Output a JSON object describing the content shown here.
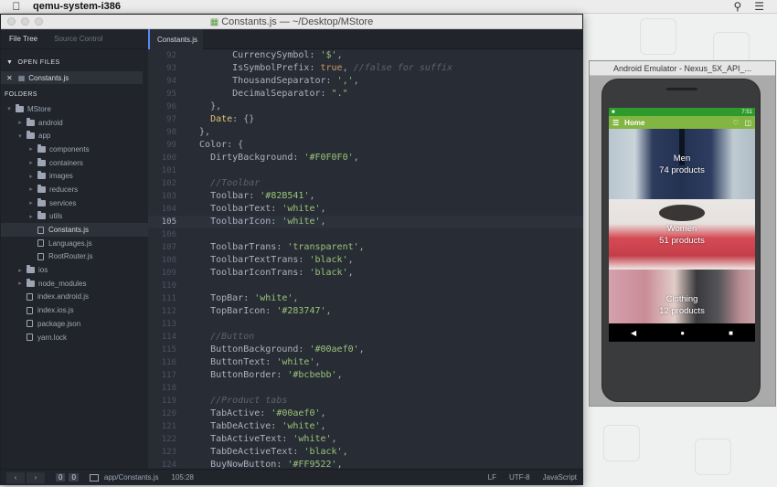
{
  "menubar": {
    "app": "qemu-system-i386"
  },
  "editor": {
    "title": "Constants.js — ~/Desktop/MStore",
    "panel_tabs": [
      "File Tree",
      "Source Control"
    ],
    "open_files_label": "OPEN FILES",
    "open_file": "Constants.js",
    "folders_label": "FOLDERS",
    "tree": [
      {
        "label": "MStore",
        "depth": 0,
        "type": "folder",
        "open": true
      },
      {
        "label": "android",
        "depth": 1,
        "type": "folder",
        "open": false
      },
      {
        "label": "app",
        "depth": 1,
        "type": "folder",
        "open": true
      },
      {
        "label": "components",
        "depth": 2,
        "type": "folder",
        "open": false
      },
      {
        "label": "containers",
        "depth": 2,
        "type": "folder",
        "open": false
      },
      {
        "label": "images",
        "depth": 2,
        "type": "folder",
        "open": false
      },
      {
        "label": "reducers",
        "depth": 2,
        "type": "folder",
        "open": false
      },
      {
        "label": "services",
        "depth": 2,
        "type": "folder",
        "open": false
      },
      {
        "label": "utils",
        "depth": 2,
        "type": "folder",
        "open": false
      },
      {
        "label": "Constants.js",
        "depth": 2,
        "type": "file",
        "selected": true
      },
      {
        "label": "Languages.js",
        "depth": 2,
        "type": "file"
      },
      {
        "label": "RootRouter.js",
        "depth": 2,
        "type": "file"
      },
      {
        "label": "ios",
        "depth": 1,
        "type": "folder",
        "open": false
      },
      {
        "label": "node_modules",
        "depth": 1,
        "type": "folder",
        "open": false
      },
      {
        "label": "index.android.js",
        "depth": 1,
        "type": "file"
      },
      {
        "label": "index.ios.js",
        "depth": 1,
        "type": "file"
      },
      {
        "label": "package.json",
        "depth": 1,
        "type": "file"
      },
      {
        "label": "yarn.lock",
        "depth": 1,
        "type": "file"
      }
    ],
    "active_tab": "Constants.js",
    "active_line": 105,
    "code": [
      {
        "n": 92,
        "t": [
          [
            "p",
            "        CurrencySymbol: "
          ],
          [
            "s",
            "'$'"
          ],
          [
            "p",
            ","
          ]
        ]
      },
      {
        "n": 93,
        "t": [
          [
            "p",
            "        IsSymbolPrefix: "
          ],
          [
            "b",
            "true"
          ],
          [
            "p",
            ", "
          ],
          [
            "c",
            "//false for suffix"
          ]
        ]
      },
      {
        "n": 94,
        "t": [
          [
            "p",
            "        ThousandSeparator: "
          ],
          [
            "s",
            "','"
          ],
          [
            "p",
            ","
          ]
        ]
      },
      {
        "n": 95,
        "t": [
          [
            "p",
            "        DecimalSeparator: "
          ],
          [
            "s",
            "\".\""
          ]
        ]
      },
      {
        "n": 96,
        "t": [
          [
            "p",
            "    },"
          ]
        ]
      },
      {
        "n": 97,
        "t": [
          [
            "y",
            "    Date"
          ],
          [
            "p",
            ": {}"
          ]
        ]
      },
      {
        "n": 98,
        "t": [
          [
            "p",
            "  },"
          ]
        ]
      },
      {
        "n": 99,
        "t": [
          [
            "p",
            "  Color: {"
          ]
        ]
      },
      {
        "n": 100,
        "t": [
          [
            "p",
            "    DirtyBackground: "
          ],
          [
            "s",
            "'#F0F0F0'"
          ],
          [
            "p",
            ","
          ]
        ]
      },
      {
        "n": 101,
        "t": []
      },
      {
        "n": 102,
        "t": [
          [
            "c",
            "    //Toolbar"
          ]
        ]
      },
      {
        "n": 103,
        "t": [
          [
            "p",
            "    Toolbar: "
          ],
          [
            "s",
            "'#82B541'"
          ],
          [
            "p",
            ","
          ]
        ]
      },
      {
        "n": 104,
        "t": [
          [
            "p",
            "    ToolbarText: "
          ],
          [
            "s",
            "'white'"
          ],
          [
            "p",
            ","
          ]
        ]
      },
      {
        "n": 105,
        "t": [
          [
            "p",
            "    ToolbarIcon: "
          ],
          [
            "s",
            "'white'"
          ],
          [
            "p",
            ","
          ]
        ]
      },
      {
        "n": 106,
        "t": []
      },
      {
        "n": 107,
        "t": [
          [
            "p",
            "    ToolbarTrans: "
          ],
          [
            "s",
            "'transparent'"
          ],
          [
            "p",
            ","
          ]
        ]
      },
      {
        "n": 108,
        "t": [
          [
            "p",
            "    ToolbarTextTrans: "
          ],
          [
            "s",
            "'black'"
          ],
          [
            "p",
            ","
          ]
        ]
      },
      {
        "n": 109,
        "t": [
          [
            "p",
            "    ToolbarIconTrans: "
          ],
          [
            "s",
            "'black'"
          ],
          [
            "p",
            ","
          ]
        ]
      },
      {
        "n": 110,
        "t": []
      },
      {
        "n": 111,
        "t": [
          [
            "p",
            "    TopBar: "
          ],
          [
            "s",
            "'white'"
          ],
          [
            "p",
            ","
          ]
        ]
      },
      {
        "n": 112,
        "t": [
          [
            "p",
            "    TopBarIcon: "
          ],
          [
            "s",
            "'#283747'"
          ],
          [
            "p",
            ","
          ]
        ]
      },
      {
        "n": 113,
        "t": []
      },
      {
        "n": 114,
        "t": [
          [
            "c",
            "    //Button"
          ]
        ]
      },
      {
        "n": 115,
        "t": [
          [
            "p",
            "    ButtonBackground: "
          ],
          [
            "s",
            "'#00aef0'"
          ],
          [
            "p",
            ","
          ]
        ]
      },
      {
        "n": 116,
        "t": [
          [
            "p",
            "    ButtonText: "
          ],
          [
            "s",
            "'white'"
          ],
          [
            "p",
            ","
          ]
        ]
      },
      {
        "n": 117,
        "t": [
          [
            "p",
            "    ButtonBorder: "
          ],
          [
            "s",
            "'#bcbebb'"
          ],
          [
            "p",
            ","
          ]
        ]
      },
      {
        "n": 118,
        "t": []
      },
      {
        "n": 119,
        "t": [
          [
            "c",
            "    //Product tabs"
          ]
        ]
      },
      {
        "n": 120,
        "t": [
          [
            "p",
            "    TabActive: "
          ],
          [
            "s",
            "'#00aef0'"
          ],
          [
            "p",
            ","
          ]
        ]
      },
      {
        "n": 121,
        "t": [
          [
            "p",
            "    TabDeActive: "
          ],
          [
            "s",
            "'white'"
          ],
          [
            "p",
            ","
          ]
        ]
      },
      {
        "n": 122,
        "t": [
          [
            "p",
            "    TabActiveText: "
          ],
          [
            "s",
            "'white'"
          ],
          [
            "p",
            ","
          ]
        ]
      },
      {
        "n": 123,
        "t": [
          [
            "p",
            "    TabDeActiveText: "
          ],
          [
            "s",
            "'black'"
          ],
          [
            "p",
            ","
          ]
        ]
      },
      {
        "n": 124,
        "t": [
          [
            "p",
            "    BuyNowButton: "
          ],
          [
            "s",
            "'#FF9522'"
          ],
          [
            "p",
            ","
          ]
        ]
      }
    ],
    "status": {
      "nav_back": "‹",
      "nav_fwd": "›",
      "count_a": "0",
      "count_b": "0",
      "path": "app/Constants.js",
      "cursor": "105:28",
      "line_ending": "LF",
      "encoding": "UTF-8",
      "grammar": "JavaScript"
    }
  },
  "emulator": {
    "title": "Android Emulator - Nexus_5X_API_...",
    "status_time": "7:51",
    "appbar_title": "Home",
    "accent": "#82B541",
    "categories": [
      {
        "name": "Men",
        "count": "74 products"
      },
      {
        "name": "Women",
        "count": "51 products"
      },
      {
        "name": "Clothing",
        "count": "12 products"
      }
    ]
  }
}
